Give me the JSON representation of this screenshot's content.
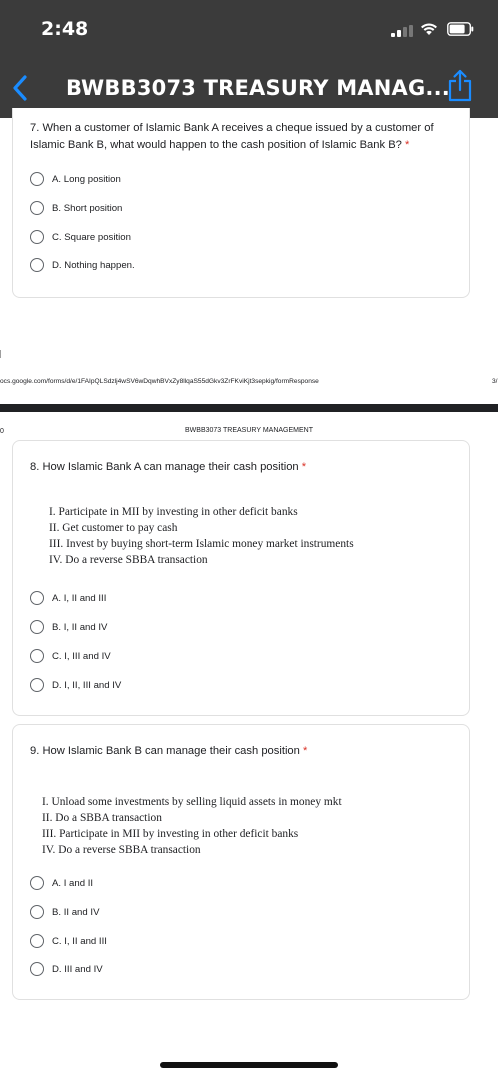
{
  "status_bar": {
    "time": "2:48"
  },
  "nav": {
    "title": "BWBB3073 TREASURY MANAG..."
  },
  "q7": {
    "text": "7. When a customer of Islamic Bank A receives a cheque issued by a customer of Islamic Bank B, what would happen to the cash position of Islamic Bank B?",
    "required": "*",
    "options": [
      "A. Long position",
      "B. Short position",
      "C. Square position",
      "D. Nothing happen."
    ]
  },
  "footer": {
    "url": "ocs.google.com/forms/d/e/1FAIpQLSdzlj4wSV6wDqwhBVxZy8llqaS55dGkv3ZrFKviKjt3sepkig/formResponse",
    "page": "3/"
  },
  "page2": {
    "left_mark": "0",
    "header": "BWBB3073 TREASURY MANAGEMENT"
  },
  "q8": {
    "text": "8. How Islamic Bank A can manage their cash position",
    "required": "*",
    "statements": [
      "I.   Participate in MII by investing in other deficit banks",
      "II.  Get customer to pay cash",
      "III. Invest by buying short-term Islamic money market instruments",
      "IV. Do a reverse SBBA transaction"
    ],
    "options": [
      "A. I, II and III",
      "B. I, II and IV",
      "C. I, III and IV",
      "D. I, II, III and IV"
    ]
  },
  "q9": {
    "text": "9. How Islamic Bank B can manage their cash position",
    "required": "*",
    "statements": [
      "I.   Unload some investments by selling liquid assets in money mkt",
      "II.  Do a SBBA transaction",
      "III. Participate in MII by investing in other deficit banks",
      "IV. Do a reverse SBBA transaction"
    ],
    "options": [
      "A. I and II",
      "B. II and IV",
      "C. I, II and III",
      "D. III and IV"
    ]
  },
  "colors": {
    "header_bg": "#3b3b3b",
    "accent": "#1a8cff",
    "required": "#d93025"
  }
}
